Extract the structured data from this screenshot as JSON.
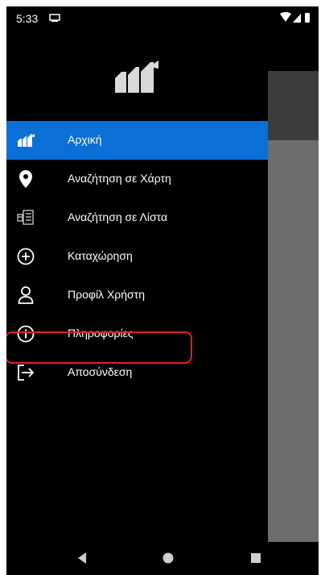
{
  "status_bar": {
    "time": "5:33"
  },
  "drawer": {
    "menu": [
      {
        "label": "Αρχική",
        "icon": "home-logo-icon",
        "active": true
      },
      {
        "label": "Αναζήτηση σε Χάρτη",
        "icon": "map-pin-icon"
      },
      {
        "label": "Αναζήτηση σε Λίστα",
        "icon": "list-search-icon"
      },
      {
        "label": "Καταχώρηση",
        "icon": "add-circle-icon"
      },
      {
        "label": "Προφίλ Χρήστη",
        "icon": "user-icon"
      },
      {
        "label": "Πληροφορίες",
        "icon": "info-icon"
      },
      {
        "label": "Αποσύνδεση",
        "icon": "logout-icon",
        "highlighted": true
      }
    ]
  },
  "colors": {
    "accent": "#0a6fd6",
    "highlight_border": "#e0202a",
    "background": "#000000"
  },
  "nav_bar": {
    "buttons": [
      "back-icon",
      "home-icon",
      "recents-icon"
    ]
  }
}
